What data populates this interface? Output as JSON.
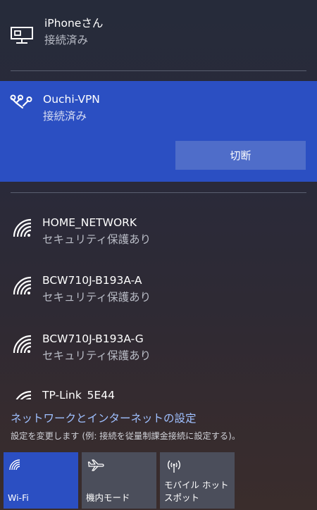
{
  "connections": [
    {
      "name": "iPhoneさん",
      "status": "接続済み",
      "icon": "desktop-icon"
    },
    {
      "name": "Ouchi-VPN",
      "status": "接続済み",
      "icon": "vpn-icon",
      "action_label": "切断"
    }
  ],
  "networks": [
    {
      "name": "HOME_NETWORK",
      "status": "セキュリティ保護あり",
      "icon": "wifi-secured-icon"
    },
    {
      "name": "BCW710J-B193A-A",
      "status": "セキュリティ保護あり",
      "icon": "wifi-secured-icon"
    },
    {
      "name": "BCW710J-B193A-G",
      "status": "セキュリティ保護あり",
      "icon": "wifi-secured-icon"
    },
    {
      "name": "TP-Link_5E44",
      "icon": "wifi-icon"
    }
  ],
  "settings": {
    "link_text": "ネットワークとインターネットの設定",
    "description": "設定を変更します (例: 接続を従量制課金接続に設定する)。"
  },
  "quick_actions": [
    {
      "label": "Wi-Fi",
      "icon": "wifi-icon",
      "active": true
    },
    {
      "label": "機内モード",
      "icon": "airplane-icon",
      "active": false
    },
    {
      "label": "モバイル ホットスポット",
      "icon": "hotspot-icon",
      "active": false
    }
  ],
  "colors": {
    "accent": "#2b4fc2",
    "button": "#4f6dc9",
    "link": "#9fc0ff",
    "tile": "#4b4e5b"
  }
}
